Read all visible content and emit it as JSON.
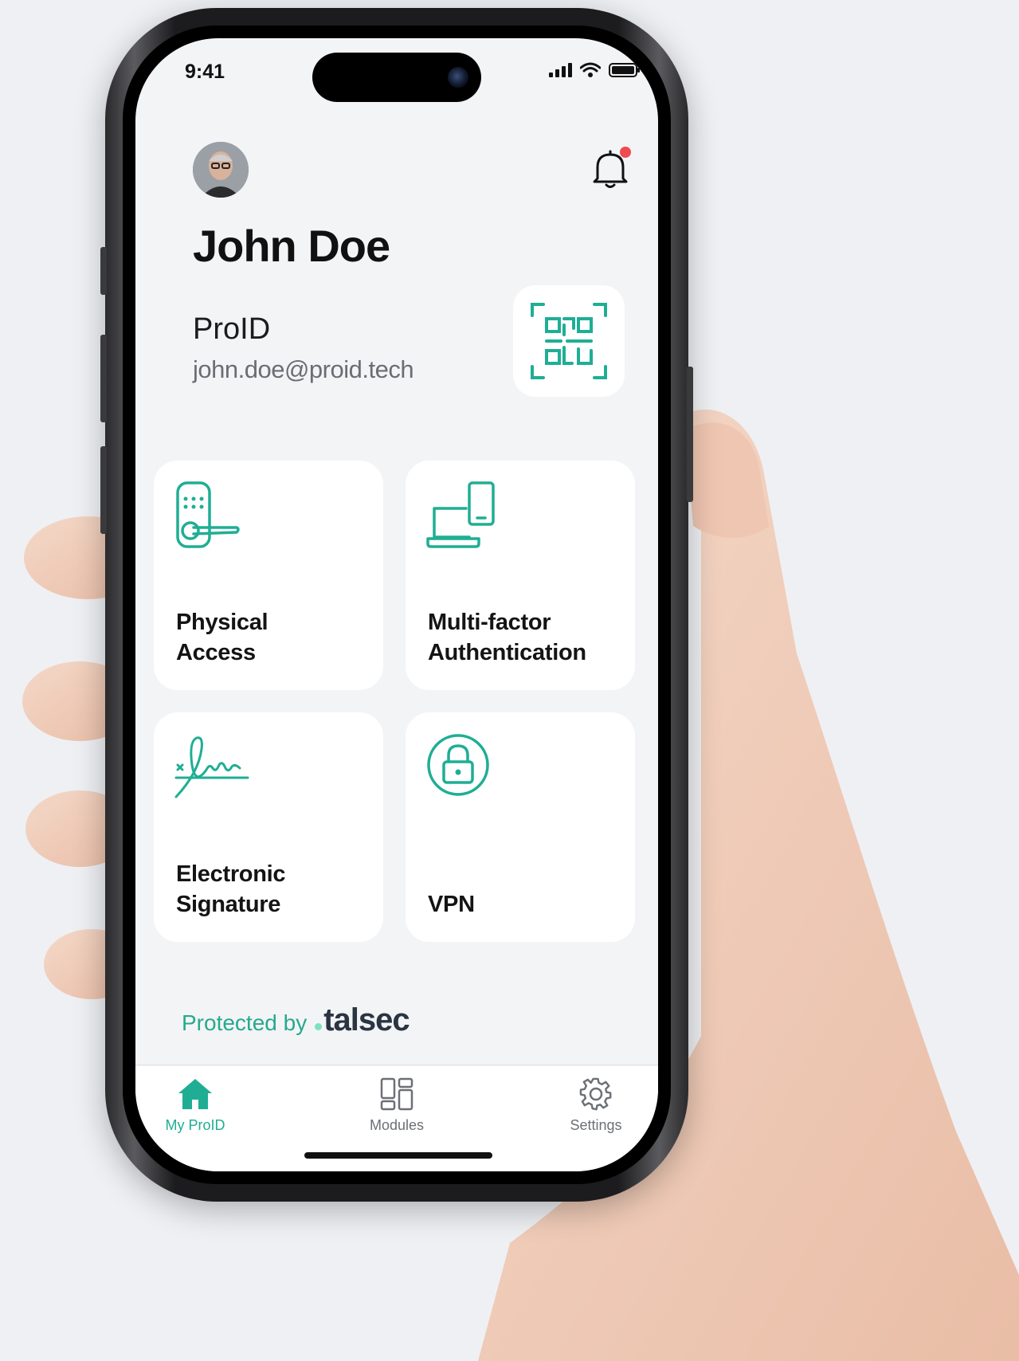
{
  "status_bar": {
    "time": "9:41"
  },
  "profile": {
    "name": "John Doe",
    "brand": "ProID",
    "email": "john.doe@proid.tech"
  },
  "modules": [
    {
      "label": "Physical\nAccess",
      "icon": "door-lock-icon"
    },
    {
      "label": "Multi-factor\nAuthentication",
      "icon": "devices-icon"
    },
    {
      "label": "Electronic\nSignature",
      "icon": "signature-icon"
    },
    {
      "label": "VPN",
      "icon": "lock-icon"
    }
  ],
  "footer": {
    "protected_by": "Protected by",
    "brand": "talsec"
  },
  "tab_bar": {
    "items": [
      {
        "label": "My ProID",
        "icon": "home-icon",
        "active": true
      },
      {
        "label": "Modules",
        "icon": "grid-icon",
        "active": false
      },
      {
        "label": "Settings",
        "icon": "gear-icon",
        "active": false
      }
    ]
  },
  "colors": {
    "accent": "#1fae94",
    "background": "#f3f4f6",
    "notification": "#ef4a4f",
    "text": "#141414"
  }
}
